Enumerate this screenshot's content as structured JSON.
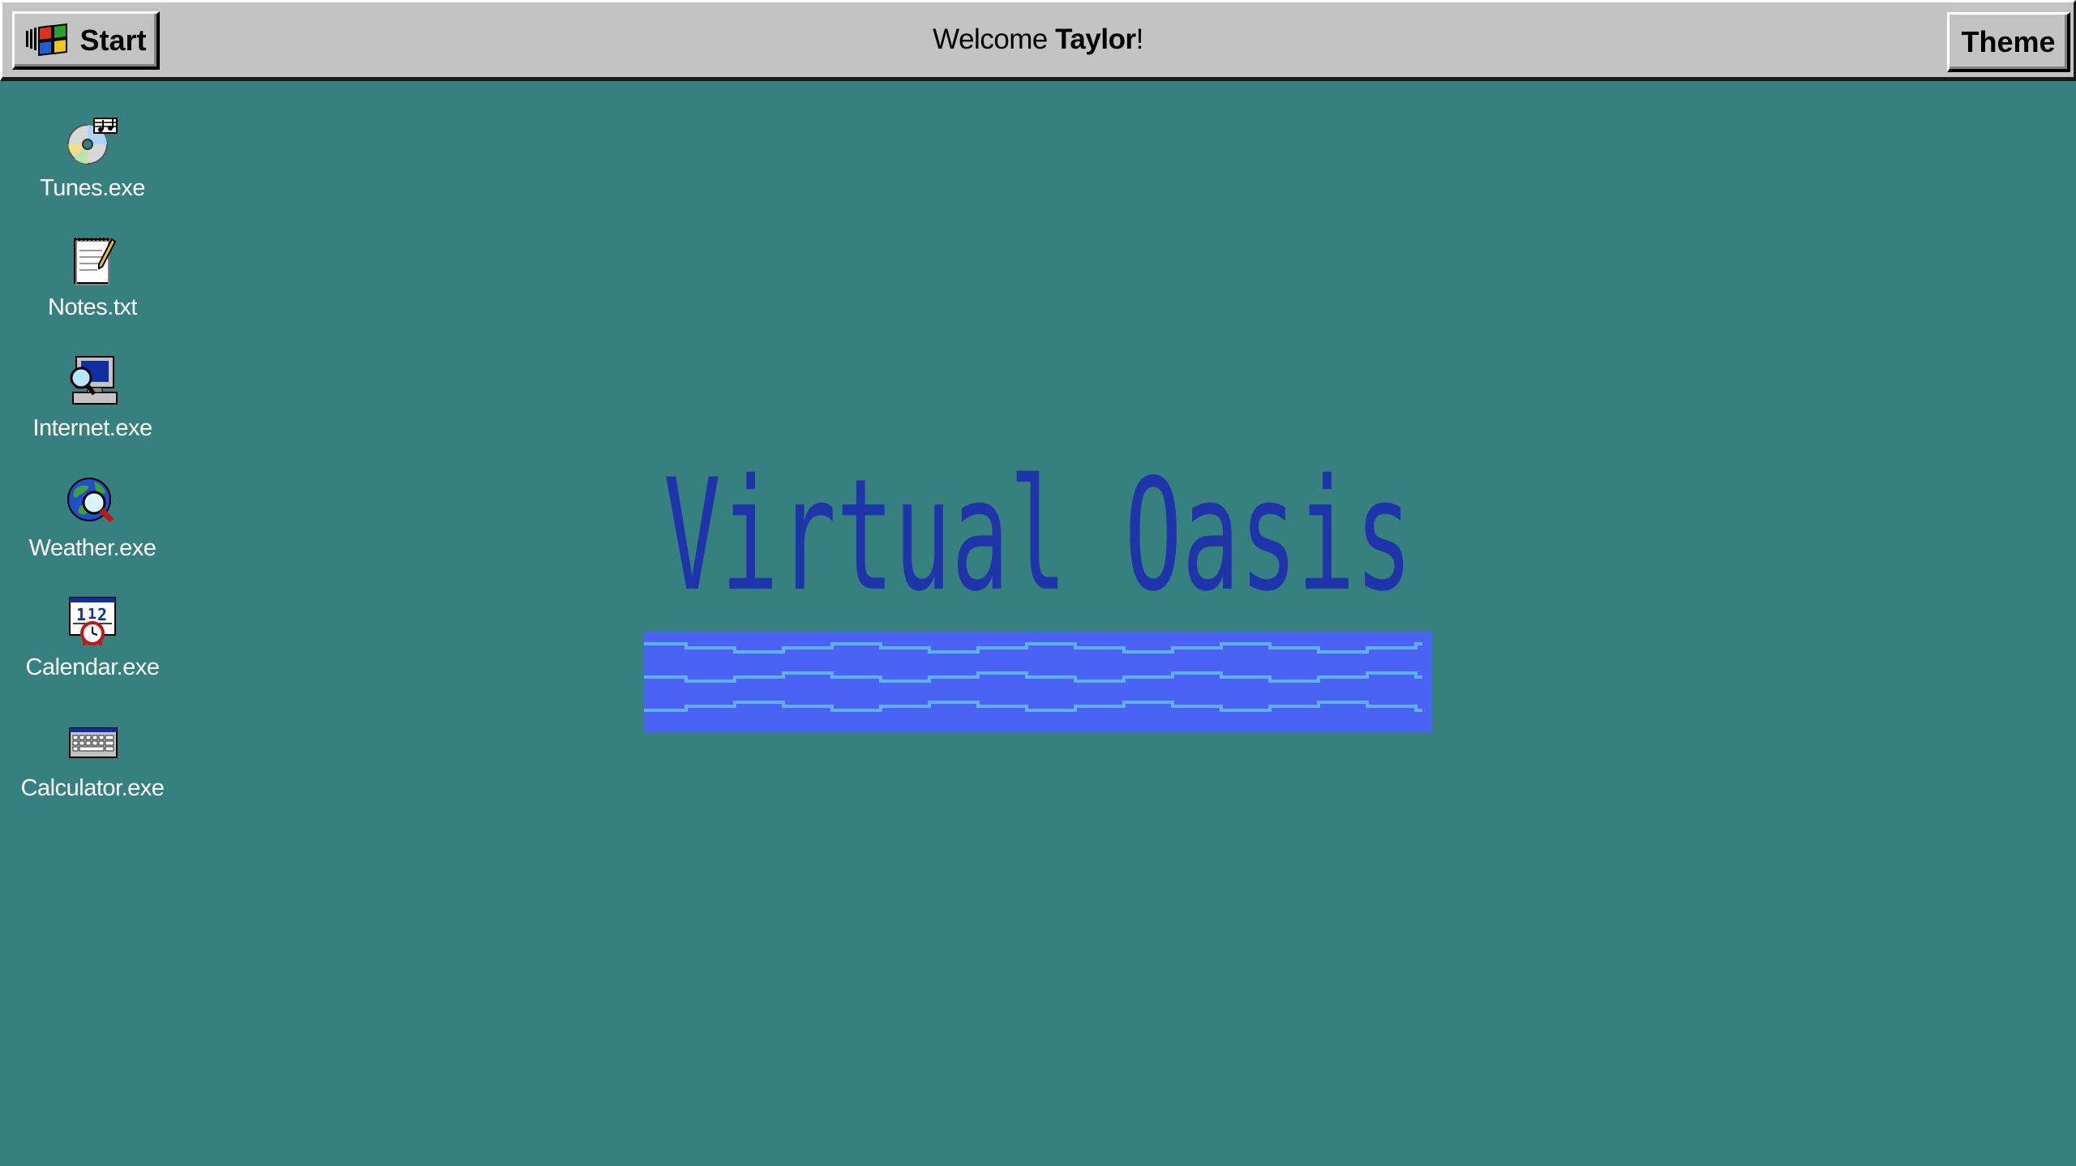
{
  "taskbar": {
    "start_label": "Start",
    "welcome_prefix": "Welcome ",
    "welcome_user": "Taylor",
    "welcome_suffix": "!",
    "theme_label": "Theme"
  },
  "desktop": {
    "background_color": "#368080",
    "icons": [
      {
        "label": "Tunes.exe",
        "icon": "cd-music-icon"
      },
      {
        "label": "Notes.txt",
        "icon": "notepad-icon"
      },
      {
        "label": "Internet.exe",
        "icon": "computer-search-icon"
      },
      {
        "label": "Weather.exe",
        "icon": "globe-magnifier-icon"
      },
      {
        "label": "Calendar.exe",
        "icon": "calendar-clock-icon"
      },
      {
        "label": "Calculator.exe",
        "icon": "keyboard-icon"
      }
    ]
  },
  "logo": {
    "title": "Virtual Oasis",
    "title_color": "#1f34a8",
    "water_color": "#4b63f5",
    "wave_color": "#5fb0f0"
  }
}
